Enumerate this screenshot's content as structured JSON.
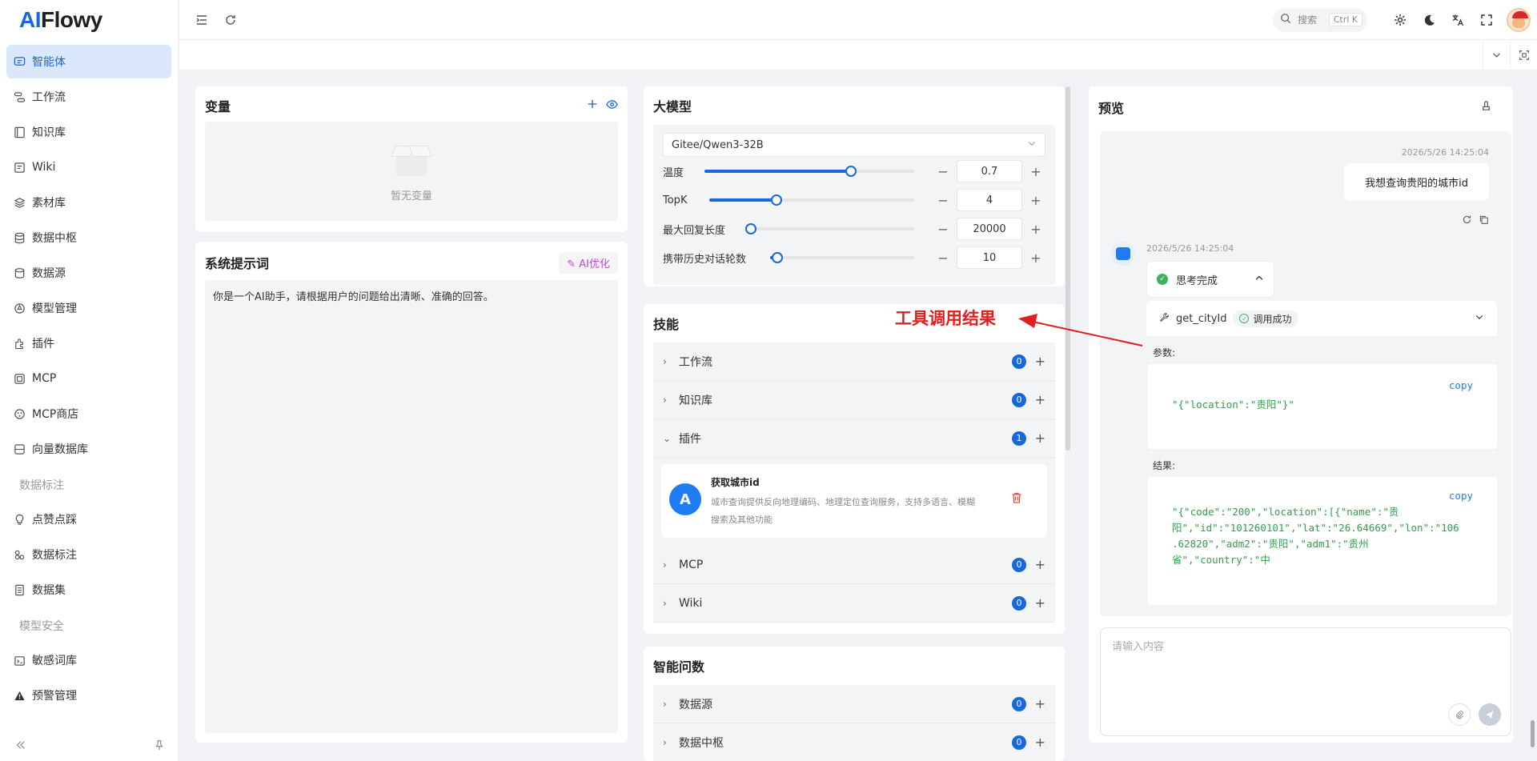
{
  "app": {
    "logo_ai": "AI",
    "logo_rest": "Flowy"
  },
  "sidebar": {
    "items": [
      {
        "label": "智能体",
        "icon": "agent-icon",
        "active": true
      },
      {
        "label": "工作流",
        "icon": "workflow-icon"
      },
      {
        "label": "知识库",
        "icon": "knowledge-icon"
      },
      {
        "label": "Wiki",
        "icon": "wiki-icon"
      },
      {
        "label": "素材库",
        "icon": "material-icon"
      },
      {
        "label": "数据中枢",
        "icon": "database-icon"
      },
      {
        "label": "数据源",
        "icon": "datasource-icon"
      },
      {
        "label": "模型管理",
        "icon": "model-icon"
      },
      {
        "label": "插件",
        "icon": "plugin-icon"
      },
      {
        "label": "MCP",
        "icon": "mcp-icon"
      },
      {
        "label": "MCP商店",
        "icon": "store-icon"
      },
      {
        "label": "向量数据库",
        "icon": "vector-db-icon"
      }
    ],
    "group1": "数据标注",
    "group1_items": [
      {
        "label": "点赞点踩",
        "icon": "bulb-icon"
      },
      {
        "label": "数据标注",
        "icon": "annotate-icon"
      },
      {
        "label": "数据集",
        "icon": "dataset-icon"
      }
    ],
    "group2": "模型安全",
    "group2_items": [
      {
        "label": "敏感词库",
        "icon": "sensitive-icon"
      },
      {
        "label": "预警管理",
        "icon": "warning-icon"
      }
    ]
  },
  "topbar": {
    "search_label": "搜索",
    "search_shortcut": "Ctrl K"
  },
  "variables": {
    "title": "变量",
    "empty_text": "暂无变量"
  },
  "prompt": {
    "title": "系统提示词",
    "ai_optimize": "AI优化",
    "content": "你是一个AI助手，请根据用户的问题给出清晰、准确的回答。"
  },
  "model": {
    "title": "大模型",
    "selected": "Gitee/Qwen3-32B",
    "params": [
      {
        "name": "温度",
        "value": "0.7",
        "fraction": 0.7
      },
      {
        "name": "TopK",
        "value": "4",
        "fraction": 0.33
      },
      {
        "name": "最大回复长度",
        "value": "20000",
        "fraction": 0.02
      },
      {
        "name": "携带历史对话轮数",
        "value": "10",
        "fraction": 0.05
      }
    ]
  },
  "skills": {
    "title": "技能",
    "rows": [
      {
        "name": "工作流",
        "count": "0"
      },
      {
        "name": "知识库",
        "count": "0"
      },
      {
        "name": "插件",
        "count": "1"
      },
      {
        "name": "MCP",
        "count": "0"
      },
      {
        "name": "Wiki",
        "count": "0"
      }
    ],
    "plugin": {
      "name": "获取城市id",
      "desc": "城市查询提供反向地理编码、地理定位查询服务，支持多语言、模糊搜索及其他功能"
    }
  },
  "qa": {
    "title": "智能问数",
    "rows": [
      {
        "name": "数据源",
        "count": "0"
      },
      {
        "name": "数据中枢",
        "count": "0"
      }
    ]
  },
  "preview": {
    "title": "预览",
    "user_time": "2026/5/26 14:25:04",
    "user_msg": "我想查询贵阳的城市id",
    "bot_time": "2026/5/26 14:25:04",
    "think_label": "思考完成",
    "tool_name": "get_cityId",
    "tool_status": "调用成功",
    "params_label": "参数:",
    "params_code": "\"{\"location\":\"贵阳\"}\"",
    "result_label": "结果:",
    "result_code_1": "\"{\"code\":\"200\",\"location\":[{\"name\":\"贵",
    "result_code_2": "阳\",\"id\":\"101260101\",\"lat\":\"26.64669\",\"lon\":\"106",
    "result_code_3": ".62820\",\"adm2\":\"贵阳\",\"adm1\":\"贵州",
    "result_code_4": "省\",\"country\":\"中",
    "copy_label": "copy",
    "input_placeholder": "请输入内容"
  },
  "annotation": {
    "text": "工具调用结果",
    "color": "#e02020"
  }
}
